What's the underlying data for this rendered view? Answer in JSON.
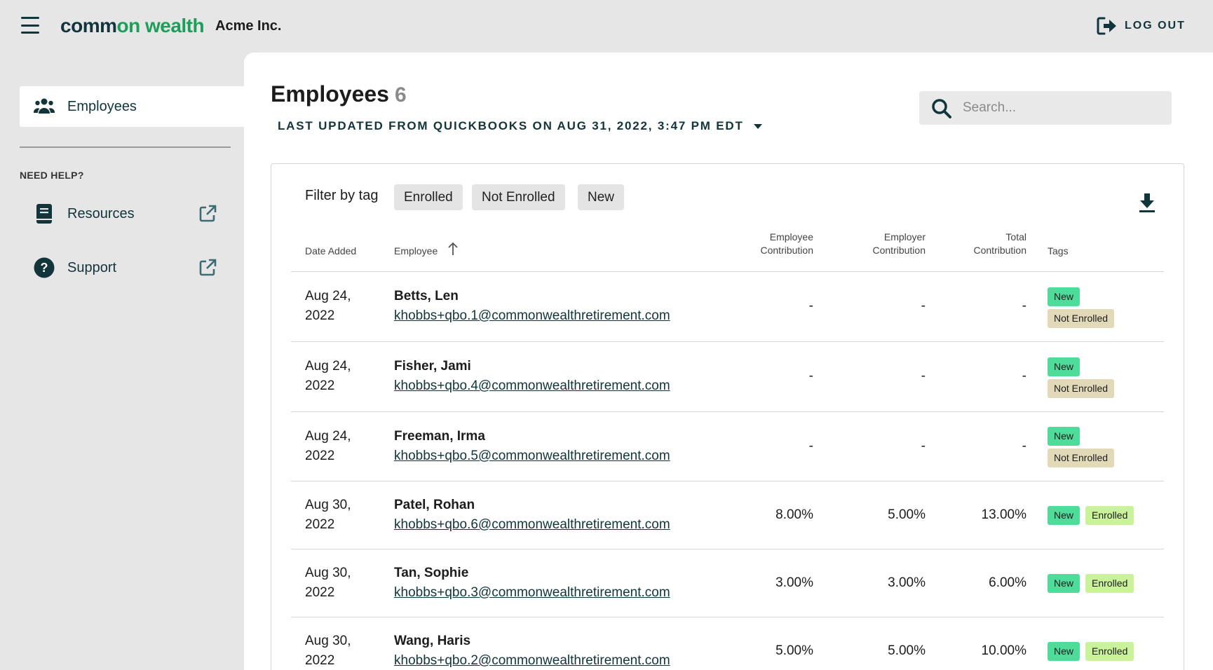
{
  "header": {
    "logo_part1": "co",
    "logo_part2": "mm",
    "logo_part3": "on wealth",
    "company": "Acme Inc.",
    "logout_label": "LOG OUT"
  },
  "sidebar": {
    "active_item": "Employees",
    "need_help_label": "NEED HELP?",
    "links": [
      {
        "label": "Resources"
      },
      {
        "label": "Support"
      }
    ]
  },
  "main": {
    "title": "Employees",
    "count": "6",
    "last_updated": "LAST UPDATED FROM QUICKBOOKS ON AUG 31, 2022, 3:47 PM EDT",
    "search_placeholder": "Search...",
    "filter_label": "Filter by tag",
    "filter_tags": [
      "Enrolled",
      "Not Enrolled",
      "New"
    ],
    "columns": {
      "date_added": "Date Added",
      "employee": "Employee",
      "employee_contribution_1": "Employee",
      "employee_contribution_2": "Contribution",
      "employer_contribution_1": "Employer",
      "employer_contribution_2": "Contribution",
      "total_contribution_1": "Total",
      "total_contribution_2": "Contribution",
      "tags": "Tags"
    },
    "rows": [
      {
        "date1": "Aug 24,",
        "date2": "2022",
        "name": "Betts, Len",
        "email": "khobbs+qbo.1@commonwealthretirement.com",
        "employee_contribution": "-",
        "employer_contribution": "-",
        "total_contribution": "-",
        "tags": [
          "New",
          "Not Enrolled"
        ]
      },
      {
        "date1": "Aug 24,",
        "date2": "2022",
        "name": "Fisher, Jami",
        "email": "khobbs+qbo.4@commonwealthretirement.com",
        "employee_contribution": "-",
        "employer_contribution": "-",
        "total_contribution": "-",
        "tags": [
          "New",
          "Not Enrolled"
        ]
      },
      {
        "date1": "Aug 24,",
        "date2": "2022",
        "name": "Freeman, Irma",
        "email": "khobbs+qbo.5@commonwealthretirement.com",
        "employee_contribution": "-",
        "employer_contribution": "-",
        "total_contribution": "-",
        "tags": [
          "New",
          "Not Enrolled"
        ]
      },
      {
        "date1": "Aug 30,",
        "date2": "2022",
        "name": "Patel, Rohan",
        "email": "khobbs+qbo.6@commonwealthretirement.com",
        "employee_contribution": "8.00%",
        "employer_contribution": "5.00%",
        "total_contribution": "13.00%",
        "tags": [
          "New",
          "Enrolled"
        ]
      },
      {
        "date1": "Aug 30,",
        "date2": "2022",
        "name": "Tan, Sophie",
        "email": "khobbs+qbo.3@commonwealthretirement.com",
        "employee_contribution": "3.00%",
        "employer_contribution": "3.00%",
        "total_contribution": "6.00%",
        "tags": [
          "New",
          "Enrolled"
        ]
      },
      {
        "date1": "Aug 30,",
        "date2": "2022",
        "name": "Wang, Haris",
        "email": "khobbs+qbo.2@commonwealthretirement.com",
        "employee_contribution": "5.00%",
        "employer_contribution": "5.00%",
        "total_contribution": "10.00%",
        "tags": [
          "New",
          "Enrolled"
        ]
      }
    ]
  },
  "colors": {
    "brand_green": "#1e9e5a",
    "brand_dark": "#12343b",
    "tag_new": "#4fdb9a",
    "tag_not_enrolled": "#e2d9b8",
    "tag_enrolled": "#c9f29b"
  },
  "icons": {
    "menu": "hamburger-menu-icon",
    "logout": "logout-icon",
    "employees": "people-icon",
    "resources": "book-icon",
    "support": "help-circle-icon",
    "external": "external-link-icon",
    "search": "search-icon",
    "download": "download-icon",
    "sort": "arrow-up-icon"
  }
}
